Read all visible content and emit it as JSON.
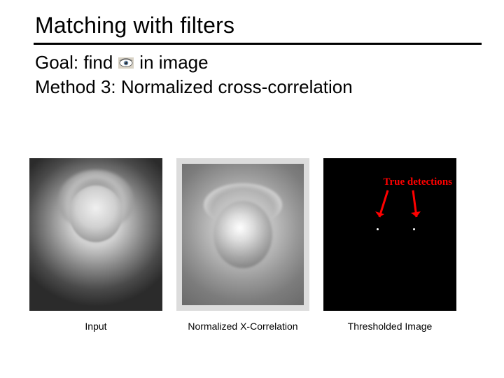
{
  "title": "Matching with filters",
  "line1_before": "Goal: find",
  "line1_after": "in image",
  "line2": "Method 3: Normalized cross-correlation",
  "icon_name": "eye-icon",
  "panels": {
    "input": {
      "caption": "Input"
    },
    "xcorr": {
      "caption": "Normalized X-Correlation"
    },
    "thresh": {
      "caption": "Thresholded Image",
      "annotation": "True detections"
    }
  }
}
